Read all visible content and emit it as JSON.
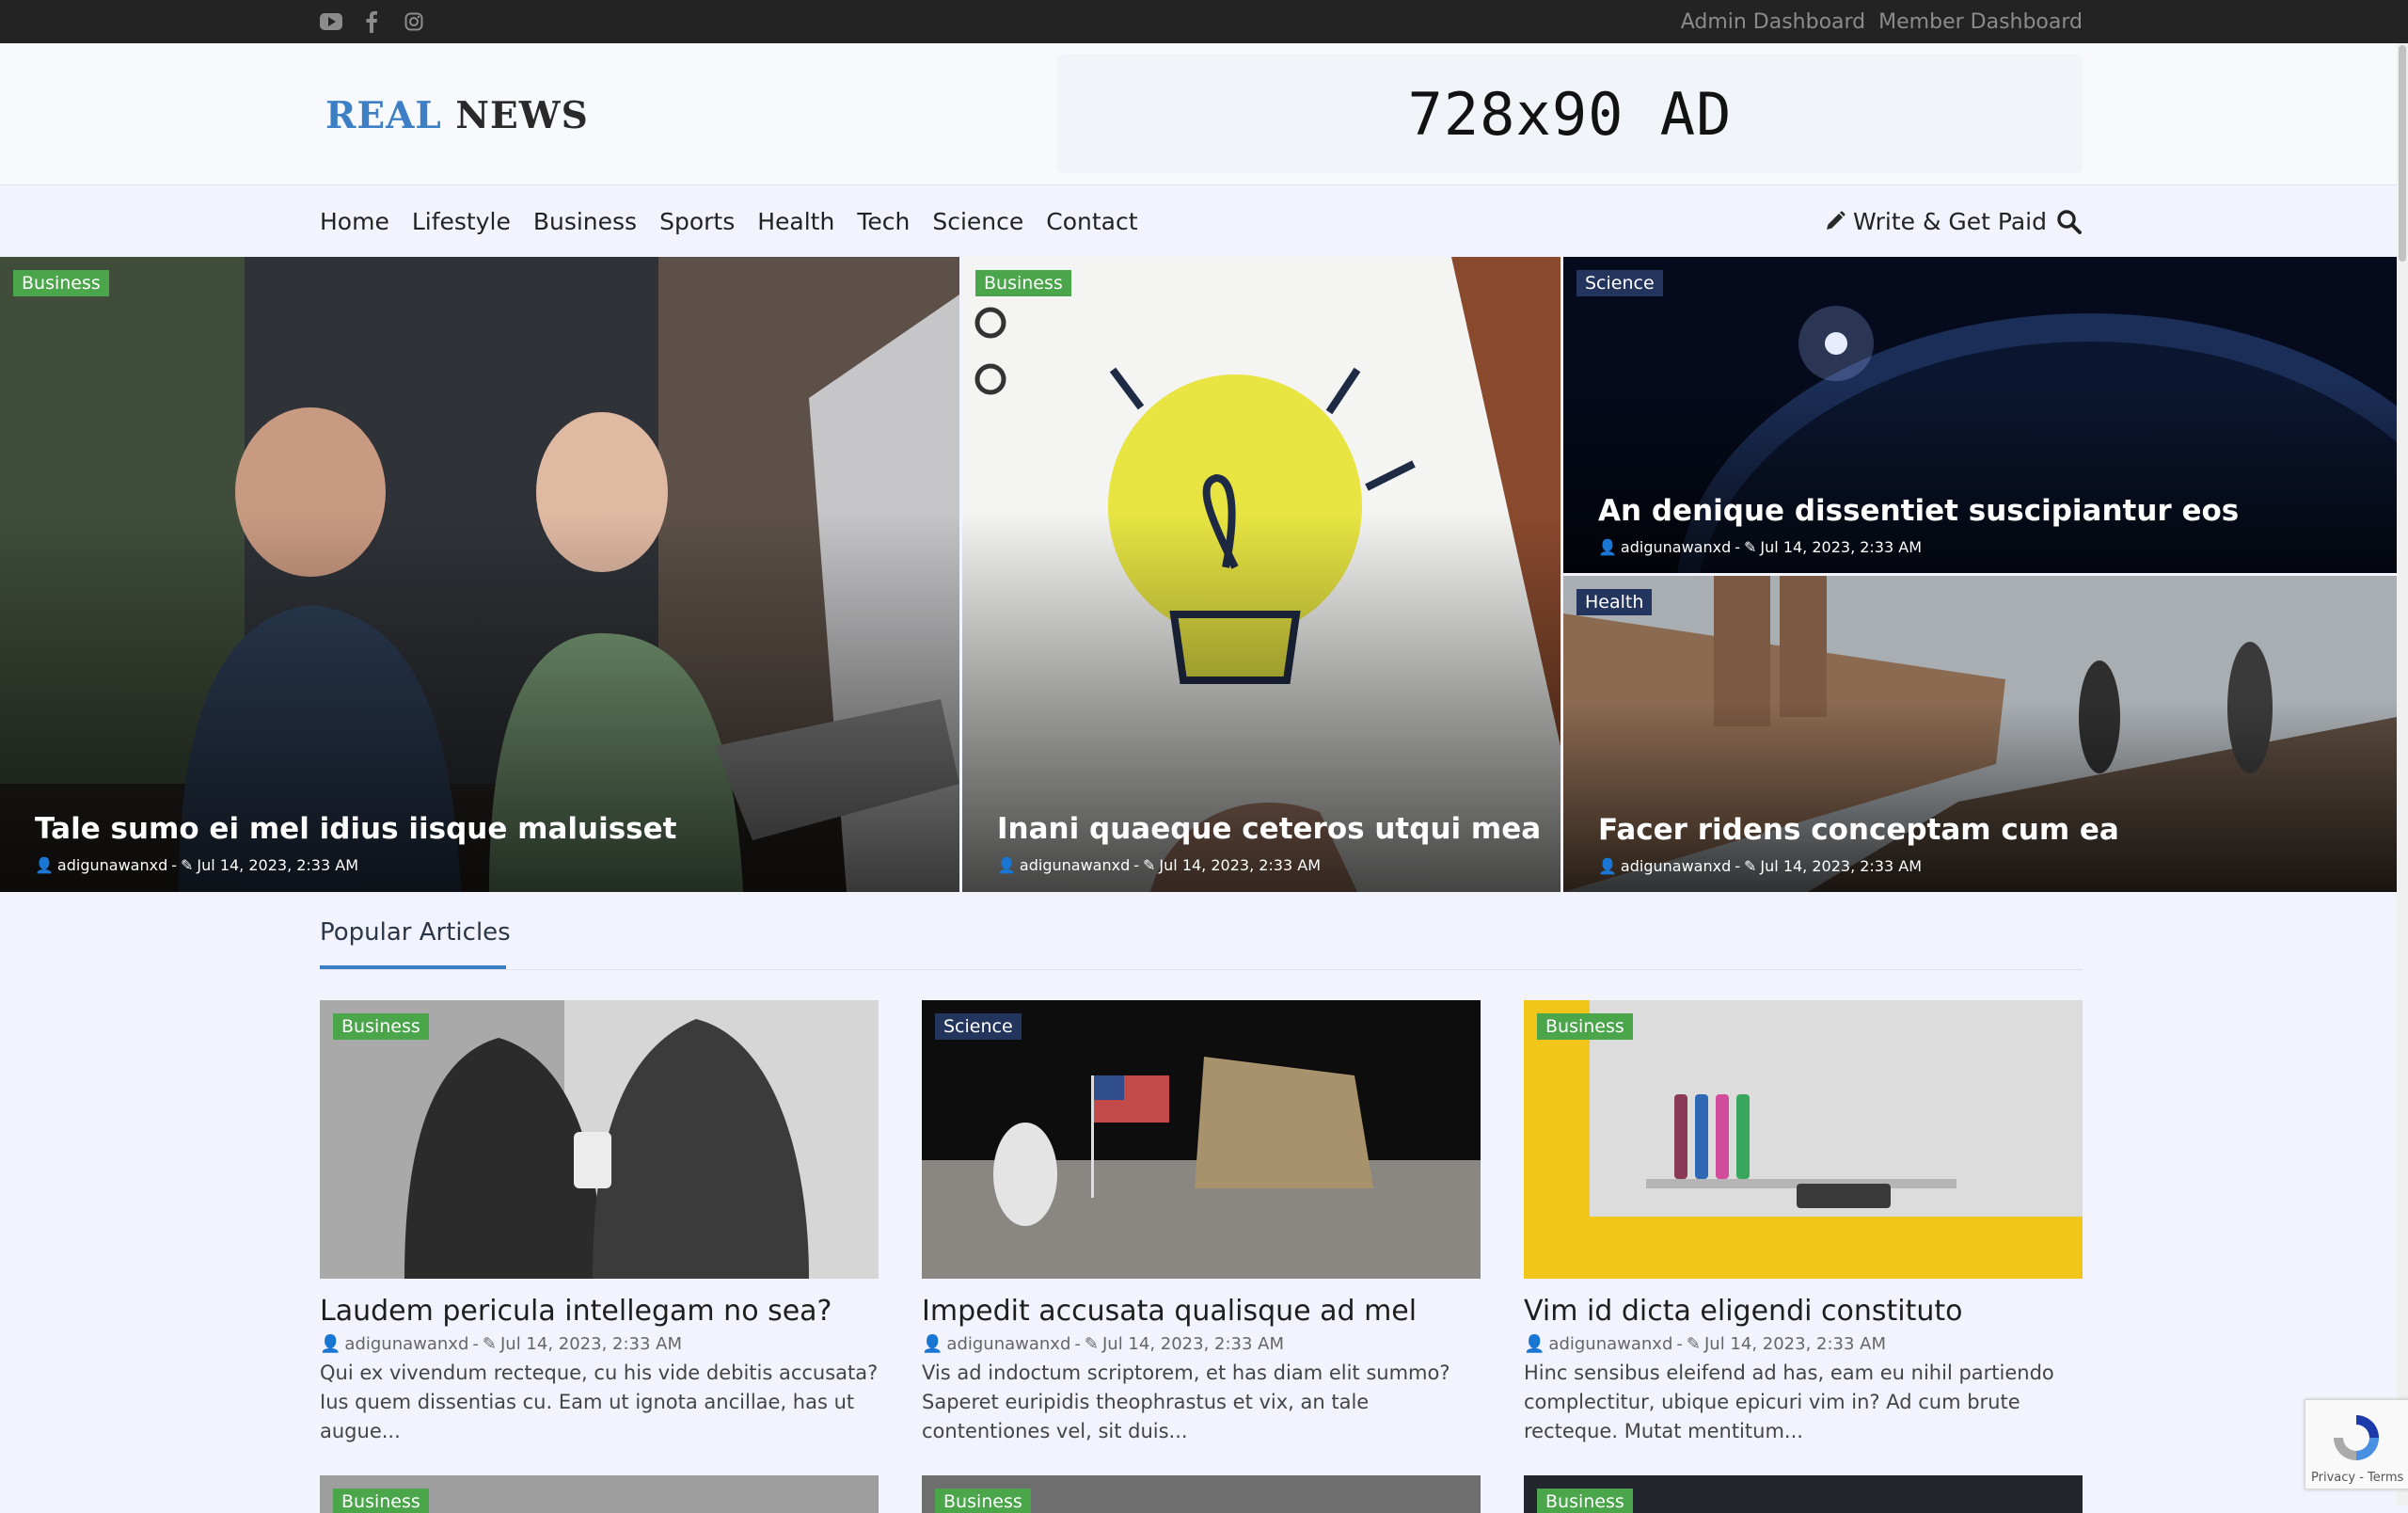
{
  "topbar": {
    "social_icons": [
      "youtube-icon",
      "facebook-icon",
      "instagram-icon"
    ],
    "links": [
      "Admin Dashboard",
      "Member Dashboard"
    ]
  },
  "header": {
    "logo_part1": "REAL",
    "logo_part2": "NEWS",
    "ad_text": "728x90 AD"
  },
  "nav": {
    "items": [
      "Home",
      "Lifestyle",
      "Business",
      "Sports",
      "Health",
      "Tech",
      "Science",
      "Contact"
    ],
    "write_label": "Write & Get Paid"
  },
  "featured": [
    {
      "category": "Business",
      "title": "Tale sumo ei mel idius iisque maluisset",
      "author": "adigunawanxd",
      "date": "Jul 14, 2023, 2:33 AM"
    },
    {
      "category": "Business",
      "title": "Inani quaeque ceteros utqui mea",
      "author": "adigunawanxd",
      "date": "Jul 14, 2023, 2:33 AM"
    },
    {
      "category": "Science",
      "title": "An denique dissentiet suscipiantur eos",
      "author": "adigunawanxd",
      "date": "Jul 14, 2023, 2:33 AM"
    },
    {
      "category": "Health",
      "title": "Facer ridens conceptam cum ea",
      "author": "adigunawanxd",
      "date": "Jul 14, 2023, 2:33 AM"
    }
  ],
  "popular": {
    "heading": "Popular Articles",
    "articles": [
      {
        "category": "Business",
        "title": "Laudem pericula intellegam no sea?",
        "author": "adigunawanxd",
        "date": "Jul 14, 2023, 2:33 AM",
        "excerpt": "Qui ex vivendum recteque, cu his vide debitis accusata? Ius quem dissentias cu. Eam ut ignota ancillae, has ut augue..."
      },
      {
        "category": "Science",
        "title": "Impedit accusata qualisque ad mel",
        "author": "adigunawanxd",
        "date": "Jul 14, 2023, 2:33 AM",
        "excerpt": "Vis ad indoctum scriptorem, et has diam elit summo? Saperet euripidis theophrastus et vix, an tale contentiones vel, sit duis..."
      },
      {
        "category": "Business",
        "title": "Vim id dicta eligendi constituto",
        "author": "adigunawanxd",
        "date": "Jul 14, 2023, 2:33 AM",
        "excerpt": "Hinc sensibus eleifend ad has, eam eu nihil partiendo complectitur, ubique epicuri vim in? Ad cum brute recteque. Mutat mentitum..."
      }
    ],
    "next_row_categories": [
      "Business",
      "Business",
      "Business"
    ]
  },
  "recaptcha": {
    "text": "Privacy - Terms"
  },
  "colors": {
    "accent": "#3c7fc5",
    "business_badge": "#4ba54a",
    "science_badge": "#23345d",
    "topbar": "#232323"
  }
}
